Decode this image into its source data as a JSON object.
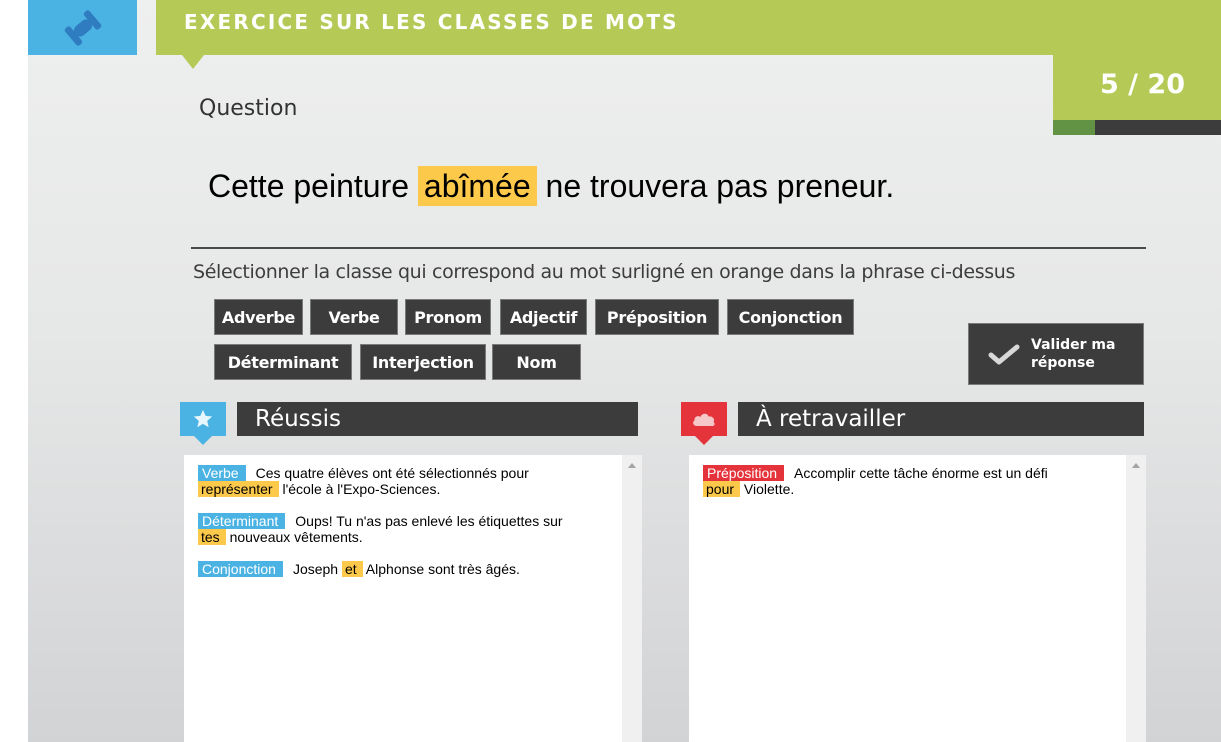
{
  "header": {
    "icon": "dumbbell-icon",
    "title": "EXERCICE SUR LES CLASSES DE MOTS",
    "counter": "5 / 20",
    "progress": {
      "current": 5,
      "total": 20,
      "fraction": 0.25
    }
  },
  "question": {
    "label": "Question",
    "sentence_before": "Cette peinture",
    "highlighted_word": "abîmée",
    "sentence_after": "ne trouvera pas preneur."
  },
  "instruction": "Sélectionner la classe qui correspond au mot surligné en orange dans la phrase ci-dessus",
  "choices": [
    "Adverbe",
    "Verbe",
    "Pronom",
    "Adjectif",
    "Préposition",
    "Conjonction",
    "Déterminant",
    "Interjection",
    "Nom"
  ],
  "validate_button": {
    "icon": "checkmark-icon",
    "line1": "Valider ma",
    "line2": "réponse"
  },
  "success": {
    "icon": "star-icon",
    "title": "Réussis",
    "entries": [
      {
        "tag": "Verbe",
        "before": "Ces quatre élèves ont été sélectionnés pour",
        "word": "représenter",
        "after": "l'école à l'Expo-Sciences.",
        "word_first_line2": true
      },
      {
        "tag": "Déterminant",
        "before": "Oups! Tu n'as pas enlevé les étiquettes sur",
        "word": "tes",
        "after": "nouveaux vêtements."
      },
      {
        "tag": "Conjonction",
        "before": "Joseph",
        "word": "et",
        "after": "Alphonse sont très âgés."
      }
    ]
  },
  "rework": {
    "icon": "cloud-icon",
    "title": "À retravailler",
    "entries": [
      {
        "tag": "Préposition",
        "before": "Accomplir cette tâche énorme est un défi",
        "word": "pour",
        "after": "Violette."
      }
    ]
  },
  "colors": {
    "header_green": "#b5ca56",
    "progress_green": "#629344",
    "accent_blue": "#4bb3e3",
    "accent_red": "#e5333c",
    "highlight_orange": "#fdc94a",
    "dark_button": "#3c3c3c"
  }
}
